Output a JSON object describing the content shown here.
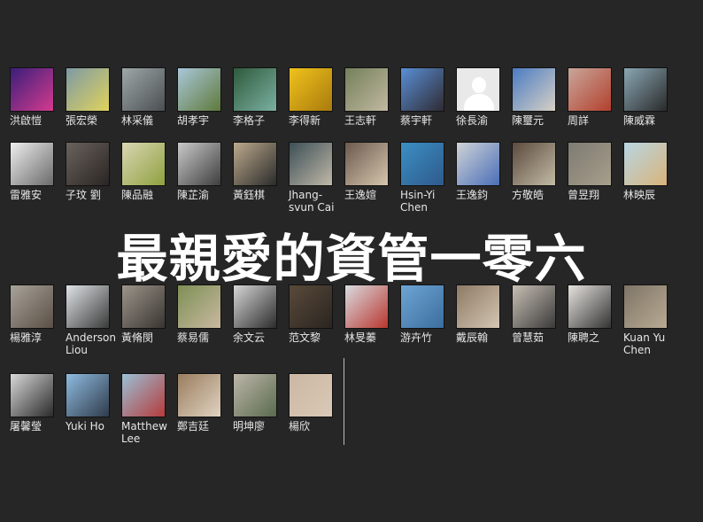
{
  "title": "最親愛的資管一零六",
  "members": [
    {
      "name": "洪啟愷",
      "colors": [
        "#3a1f7a",
        "#d43a8e"
      ]
    },
    {
      "name": "張宏榮",
      "colors": [
        "#7e9aa4",
        "#e0d35c"
      ]
    },
    {
      "name": "林采儀",
      "colors": [
        "#9fa7a9",
        "#4a4f52"
      ]
    },
    {
      "name": "胡孝宇",
      "colors": [
        "#a9c7d9",
        "#5f7a3c"
      ]
    },
    {
      "name": "李格子",
      "colors": [
        "#2f5a3c",
        "#7ab0a1"
      ]
    },
    {
      "name": "李得新",
      "colors": [
        "#f0c21c",
        "#a97b0d"
      ]
    },
    {
      "name": "王志軒",
      "colors": [
        "#74805a",
        "#c1b8a1"
      ]
    },
    {
      "name": "蔡宇軒",
      "colors": [
        "#5a8fd6",
        "#2f2b33"
      ]
    },
    {
      "name": "徐長渝",
      "colors": [
        "#e9e9e9",
        "#ffffff"
      ],
      "placeholder": true
    },
    {
      "name": "陳璽元",
      "colors": [
        "#4b7cc5",
        "#d7d0c3"
      ]
    },
    {
      "name": "周詳",
      "colors": [
        "#c9a69a",
        "#b3402d"
      ]
    },
    {
      "name": "陳威霖",
      "colors": [
        "#8aa7b4",
        "#2a2a2a"
      ]
    },
    {
      "name": "雷雅安",
      "colors": [
        "#eeeeee",
        "#6a6a6a"
      ]
    },
    {
      "name": "子玟 劉",
      "colors": [
        "#6a625d",
        "#2a2523"
      ]
    },
    {
      "name": "陳品融",
      "colors": [
        "#d9d6b3",
        "#8fa13f"
      ]
    },
    {
      "name": "陳芷渝",
      "colors": [
        "#c9c9c9",
        "#3e3e3e"
      ]
    },
    {
      "name": "黃鈺棋",
      "colors": [
        "#bca98c",
        "#2b2b2b"
      ]
    },
    {
      "name": "Jhang-svun Cai",
      "colors": [
        "#3d4f56",
        "#c0b8a8"
      ]
    },
    {
      "name": "王逸媗",
      "colors": [
        "#6b5a4e",
        "#d6c6ad"
      ]
    },
    {
      "name": "Hsin-Yi Chen",
      "colors": [
        "#3b8fc4",
        "#2f5a8c"
      ]
    },
    {
      "name": "王逸鈞",
      "colors": [
        "#cfd3d6",
        "#4a6eb8"
      ]
    },
    {
      "name": "方敬皓",
      "colors": [
        "#5b4a3e",
        "#c3bba5"
      ]
    },
    {
      "name": "曾昱翔",
      "colors": [
        "#7d7b73",
        "#a89e8b"
      ]
    },
    {
      "name": "林映辰",
      "colors": [
        "#b8d6e2",
        "#d9b37a"
      ]
    },
    {
      "name": "楊雅淳",
      "colors": [
        "#a8a39a",
        "#5a4f45"
      ]
    },
    {
      "name": "Anderson Liou",
      "colors": [
        "#dfe3e5",
        "#3a3a3a"
      ]
    },
    {
      "name": "黃脩閔",
      "colors": [
        "#9c958a",
        "#3a3532"
      ]
    },
    {
      "name": "蔡易儒",
      "colors": [
        "#7d8f55",
        "#c9b9a0"
      ]
    },
    {
      "name": "余文云",
      "colors": [
        "#d6d6d6",
        "#2c2c2c"
      ]
    },
    {
      "name": "范文黎",
      "colors": [
        "#5a4a3b",
        "#2a2520"
      ]
    },
    {
      "name": "林旻蓁",
      "colors": [
        "#d9dce0",
        "#b9362f"
      ]
    },
    {
      "name": "游卉竹",
      "colors": [
        "#6ea5d4",
        "#3b6e9e"
      ]
    },
    {
      "name": "戴辰翰",
      "colors": [
        "#8e7a64",
        "#d3c6b4"
      ]
    },
    {
      "name": "曾慧茹",
      "colors": [
        "#c8bfb4",
        "#3a3a3a"
      ]
    },
    {
      "name": "陳聘之",
      "colors": [
        "#e6e3de",
        "#333333"
      ]
    },
    {
      "name": "Kuan Yu Chen",
      "colors": [
        "#7e7567",
        "#b9aa93"
      ]
    },
    {
      "name": "屠馨瑩",
      "colors": [
        "#d8d8d8",
        "#2a2a2a"
      ]
    },
    {
      "name": "Yuki Ho",
      "colors": [
        "#8fbbe0",
        "#2f3b4a"
      ]
    },
    {
      "name": "Matthew Lee",
      "colors": [
        "#9ac0d6",
        "#b53b3b"
      ]
    },
    {
      "name": "鄭吉廷",
      "colors": [
        "#9a7d5f",
        "#e0d3c0"
      ]
    },
    {
      "name": "明坤廖",
      "colors": [
        "#bdb6aa",
        "#5a6b4c"
      ]
    },
    {
      "name": "楊欣",
      "colors": [
        "#cbb7a3",
        "#d9c9b6"
      ]
    }
  ]
}
